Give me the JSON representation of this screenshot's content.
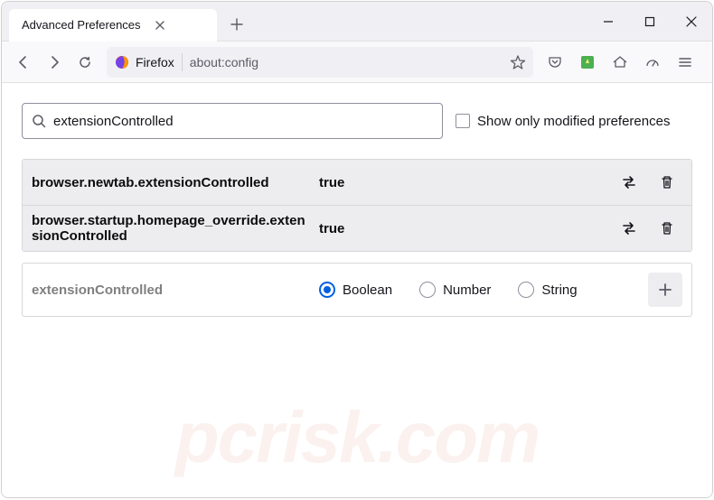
{
  "titlebar": {
    "tab_title": "Advanced Preferences"
  },
  "toolbar": {
    "firefox_label": "Firefox",
    "url_text": "about:config"
  },
  "search": {
    "value": "extensionControlled",
    "checkbox_label": "Show only modified preferences"
  },
  "prefs": [
    {
      "name": "browser.newtab.extensionControlled",
      "value": "true"
    },
    {
      "name": "browser.startup.homepage_override.extensionControlled",
      "value": "true"
    }
  ],
  "new_pref": {
    "name": "extensionControlled",
    "types": [
      "Boolean",
      "Number",
      "String"
    ],
    "selected": "Boolean"
  },
  "watermark": "pcrisk.com"
}
